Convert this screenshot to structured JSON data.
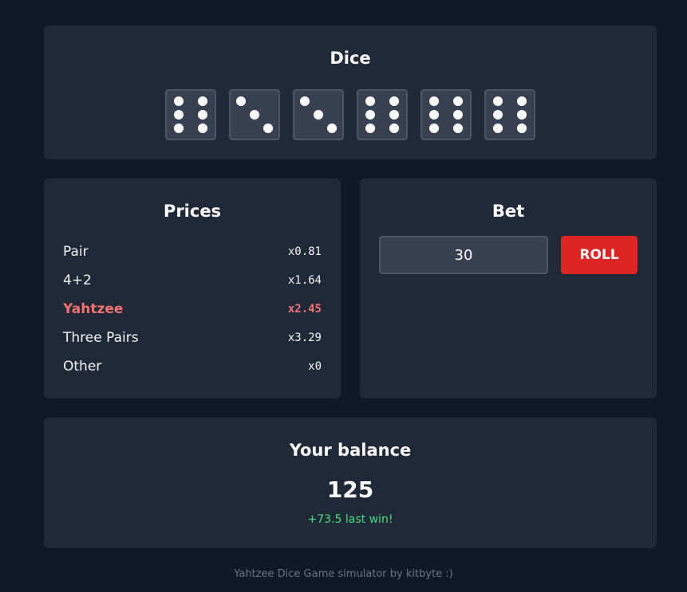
{
  "dice": {
    "title": "Dice",
    "values": [
      6,
      3,
      3,
      6,
      6,
      6
    ]
  },
  "prices": {
    "title": "Prices",
    "items": [
      {
        "name": "Pair",
        "multiplier": "x0.81",
        "highlight": false
      },
      {
        "name": "4+2",
        "multiplier": "x1.64",
        "highlight": false
      },
      {
        "name": "Yahtzee",
        "multiplier": "x2.45",
        "highlight": true
      },
      {
        "name": "Three Pairs",
        "multiplier": "x3.29",
        "highlight": false
      },
      {
        "name": "Other",
        "multiplier": "x0",
        "highlight": false
      }
    ]
  },
  "bet": {
    "title": "Bet",
    "value": "30",
    "roll_label": "ROLL"
  },
  "balance": {
    "title": "Your balance",
    "value": "125",
    "last_win": "+73.5 last win!"
  },
  "footer": "Yahtzee Dice Game simulator by kitbyte :)",
  "colors": {
    "background": "#111827",
    "card": "#1f2937",
    "highlight": "#f87171",
    "roll_button": "#dc2626",
    "win_text": "#4ade80"
  }
}
